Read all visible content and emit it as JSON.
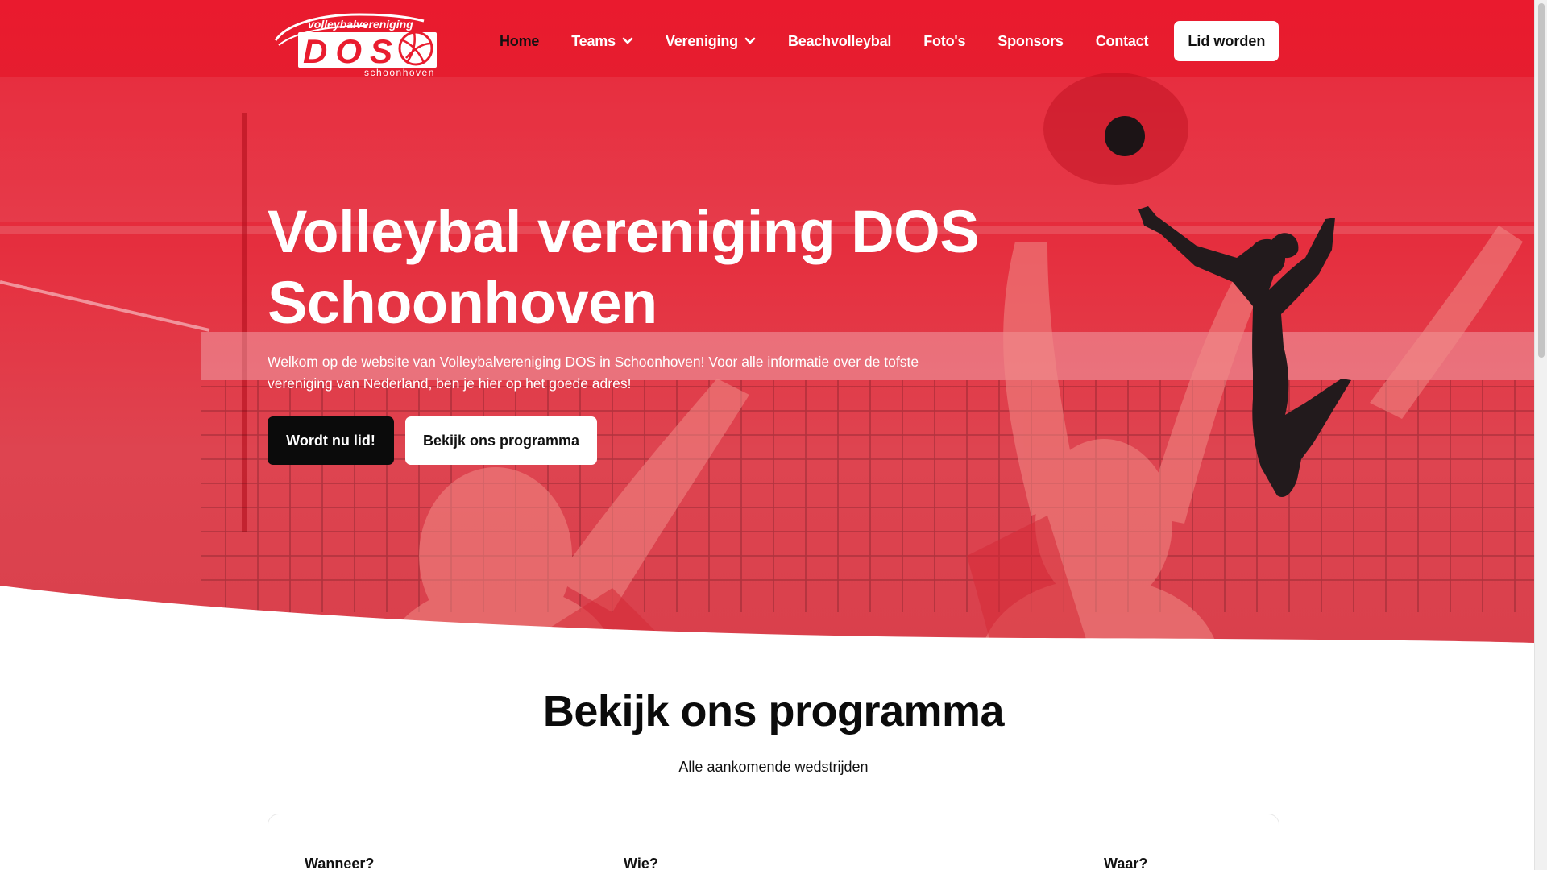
{
  "brand": {
    "logo_top": "volleybalvereniging",
    "logo_main": "DOS",
    "logo_bottom": "schoonhoven",
    "colors": {
      "primary_red": "#e91c2e",
      "dark": "#0b0b0b",
      "white": "#ffffff"
    }
  },
  "nav": {
    "items": [
      {
        "label": "Home",
        "active": true
      },
      {
        "label": "Teams",
        "dropdown": true
      },
      {
        "label": "Vereniging",
        "dropdown": true
      },
      {
        "label": "Beachvolleybal"
      },
      {
        "label": "Foto's"
      },
      {
        "label": "Sponsors"
      },
      {
        "label": "Contact"
      }
    ],
    "cta_label": "Lid worden"
  },
  "hero": {
    "title_line1": "Volleybal vereniging DOS",
    "title_line2": "Schoonhoven",
    "subtitle_line1": "Welkom op de website van Volleybalvereniging DOS in Schoonhoven! Voor alle informatie over de tofste",
    "subtitle_line2": "vereniging van Nederland, ben je hier op het goede adres!",
    "primary_button": "Wordt nu lid!",
    "secondary_button": "Bekijk ons programma",
    "background_icon": "volleyball-players-photo",
    "silhouette_icon": "volleyball-player-silhouette-icon",
    "ball_icon": "volleyball-icon"
  },
  "program": {
    "title": "Bekijk ons programma",
    "subtitle": "Alle aankomende wedstrijden",
    "columns": [
      "Wanneer?",
      "Wie?",
      "Waar?"
    ]
  }
}
